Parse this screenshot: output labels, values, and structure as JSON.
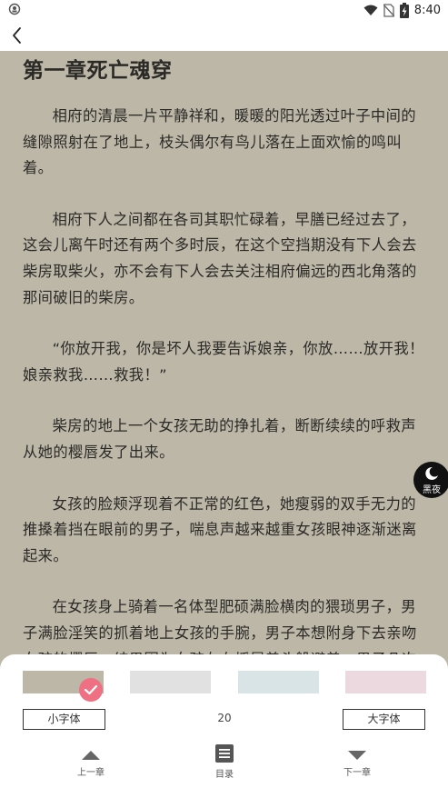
{
  "status_bar": {
    "time": "8:40",
    "icons": [
      "app-notification-icon",
      "wifi-icon",
      "no-sim-icon",
      "battery-charging-icon"
    ]
  },
  "nav": {
    "back_icon": "chevron-left-icon"
  },
  "chapter": {
    "title": "第一章死亡魂穿",
    "paragraphs": [
      "相府的清晨一片平静祥和，暖暖的阳光透过叶子中间的缝隙照射在了地上，枝头偶尔有鸟儿落在上面欢愉的鸣叫着。",
      "相府下人之间都在各司其职忙碌着，早膳已经过去了，这会儿离午时还有两个多时辰，在这个空挡期没有下人会去柴房取柴火，亦不会有下人会去关注相府偏远的西北角落的那间破旧的柴房。",
      "“你放开我，你是坏人我要告诉娘亲，你放……放开我！娘亲救我……救我！”",
      "柴房的地上一个女孩无助的挣扎着，断断续续的呼救声从她的樱唇发了出来。",
      "女孩的脸颊浮现着不正常的红色，她瘦弱的双手无力的推搡着挡在眼前的男子，喘息声越来越重女孩眼神逐渐迷离起来。",
      "在女孩身上骑着一名体型肥硕满脸横肉的猥琐男子，男子满脸淫笑的抓着地上女孩的手腕，男子本想附身下去亲吻女孩的樱唇，结果因为女孩左右摇晃着头躲避着，男子几次都扑了空。"
    ]
  },
  "night_mode": {
    "label": "黑夜",
    "icon": "moon-icon"
  },
  "settings": {
    "themes": [
      {
        "name": "beige",
        "color": "#bcb7a7",
        "selected": true
      },
      {
        "name": "gray",
        "color": "#e1e1e1",
        "selected": false
      },
      {
        "name": "blue",
        "color": "#d9e4e6",
        "selected": false
      },
      {
        "name": "pink",
        "color": "#ecd9df",
        "selected": false
      }
    ],
    "small_font_label": "小字体",
    "large_font_label": "大字体",
    "font_size": "20",
    "prev_chapter_label": "上一章",
    "toc_label": "目录",
    "next_chapter_label": "下一章"
  }
}
